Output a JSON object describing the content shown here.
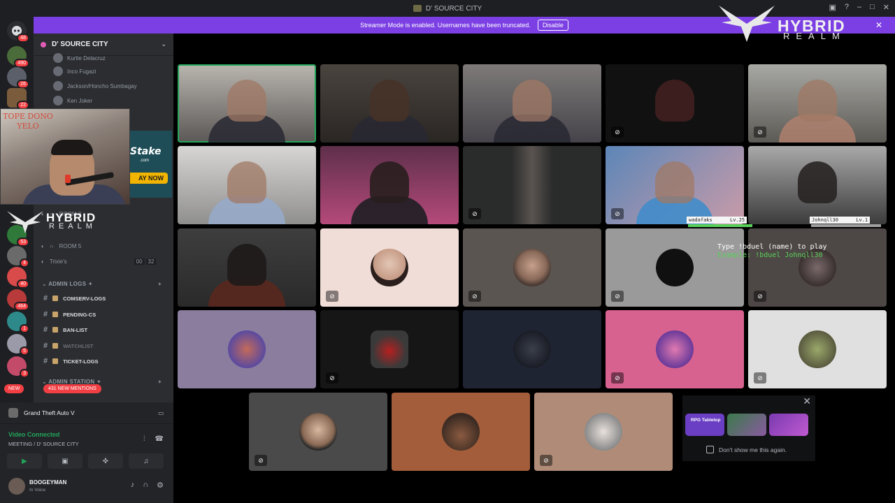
{
  "window": {
    "title": "D' SOURCE CITY"
  },
  "banner": {
    "text": "Streamer Mode is enabled. Usernames have been truncated.",
    "button": "Disable"
  },
  "rail": {
    "badges": [
      "48",
      "490",
      "26",
      "22",
      "53",
      "4",
      "40",
      "464",
      "1",
      "5",
      "3"
    ],
    "new_label": "NEW"
  },
  "server": {
    "name": "D' SOURCE CITY"
  },
  "voice_members": [
    "Kurtie Delacruz",
    "Inco Fugazi",
    "Jackson/Honcho Sumbagay",
    "Ken Joker"
  ],
  "rooms": [
    {
      "name": "ROOM 3"
    },
    {
      "name": "ROOM 5"
    },
    {
      "name": "Trixie's",
      "count_a": "00",
      "count_b": "32"
    }
  ],
  "categories": {
    "admin_logs": "ADMIN LOGS",
    "admin_station": "ADMIN STATION"
  },
  "text_channels": [
    "COMSERV-LOGS",
    "PENDING-CS",
    "BAN-LIST",
    "WATCHLIST",
    "TICKET-LOGS"
  ],
  "mentions_pill": "431 NEW MENTIONS",
  "activity": {
    "game": "Grand Theft Auto V"
  },
  "voice_connection": {
    "status": "Video Connected",
    "channel": "MEETING / D' SOURCE CITY"
  },
  "user": {
    "name": "BOOGEYMAN",
    "subtext": "In Voice"
  },
  "overlays": {
    "top_dono_line1": "TOPE DONO",
    "top_dono_line2": "YELO",
    "ad_brand": "Stake",
    "ad_domain": ".com",
    "ad_cta": "AY NOW",
    "logo_word1": "HYBRID",
    "logo_word2": "REALM"
  },
  "game_overlay": {
    "player1_name": "wadafaks",
    "player1_level": "Lv.25",
    "player2_name": "Johnqll30",
    "player2_level": "Lv.1",
    "instruction_line1": "Type !bduel (name) to play",
    "instruction_line2": "Example: !bduel Johnqll30"
  },
  "activities_popup": {
    "title": "RPG Tabletop",
    "dismiss_label": "Don't show me this again."
  },
  "colors": {
    "accent": "#7b3fe4",
    "green": "#23a55a",
    "red": "#f23f43",
    "sidebar": "#2b2d31",
    "rail": "#1e1f22"
  }
}
